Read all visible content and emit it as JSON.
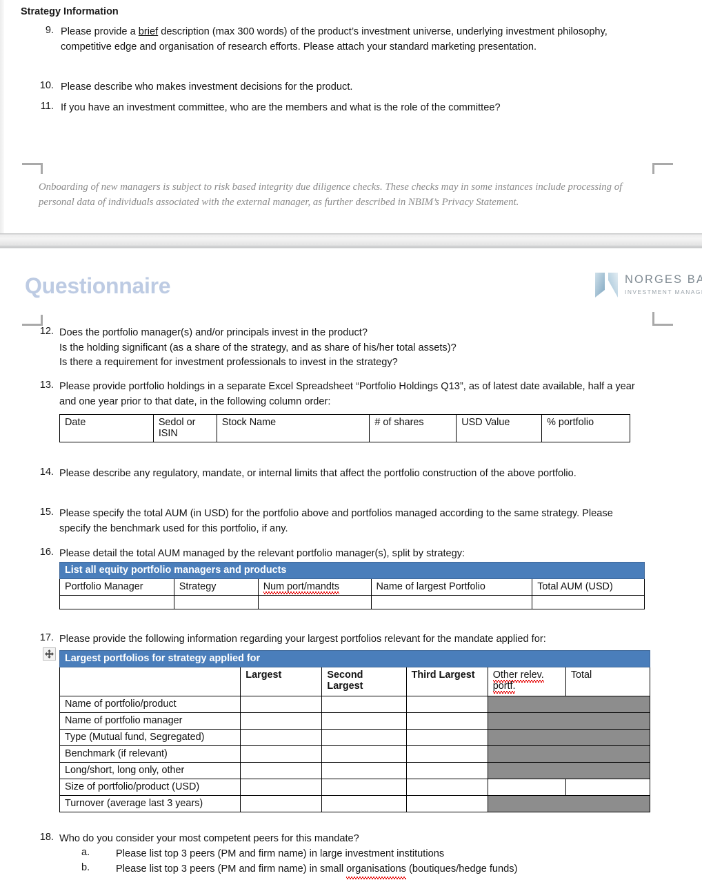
{
  "page1": {
    "section_heading": "Strategy Information",
    "questions": [
      {
        "num": "9.",
        "text": "Please provide a brief description (max 300 words) of the product’s investment universe, underlying investment philosophy, competitive edge and organisation of research efforts. Please attach your standard marketing presentation.",
        "underline_word": "brief"
      },
      {
        "num": "10.",
        "text": "Please describe who makes investment decisions for the product."
      },
      {
        "num": "11.",
        "text": "If you have an investment committee, who are the members and what is the role of the committee?"
      }
    ],
    "privacy_note": "Onboarding of new managers is subject to risk based integrity due diligence checks. These checks may in some instances include processing of personal data of individuals associated with the external manager, as further described in NBIM’s Privacy Statement."
  },
  "page2": {
    "title": "Questionnaire",
    "logo": {
      "line1": "NORGES BANK",
      "line2": "INVESTMENT MANAGEMENT",
      "mark": "nbim-n-mark"
    },
    "q12": {
      "num": "12.",
      "lines": [
        "Does the portfolio manager(s) and/or principals invest in the product?",
        "Is the holding significant (as a share of the strategy, and as share of his/her total assets)?",
        "Is there a requirement for investment professionals to invest in the strategy?"
      ]
    },
    "q13": {
      "num": "13.",
      "text": "Please provide portfolio holdings in a separate Excel Spreadsheet “Portfolio Holdings Q13”, as of latest date available, half a year and one year prior to that date, in the following column order:",
      "table": {
        "headers": [
          "Date",
          "Sedol or ISIN",
          "Stock Name",
          "# of shares",
          "USD Value",
          "% portfolio"
        ]
      }
    },
    "q14": {
      "num": "14.",
      "text": "Please describe any regulatory, mandate, or internal limits that affect the portfolio construction of the above portfolio."
    },
    "q15": {
      "num": "15.",
      "text": "Please specify the total AUM (in USD) for the portfolio above and portfolios managed according to the same strategy. Please specify the benchmark used for this portfolio, if any."
    },
    "q16": {
      "num": "16.",
      "text": "Please detail the total AUM managed by the relevant portfolio manager(s), split by strategy:",
      "table": {
        "banner": "List all equity portfolio managers and products",
        "headers": [
          "Portfolio Manager",
          "Strategy",
          "Num port/mandts",
          "Name of largest Portfolio",
          "Total AUM (USD)"
        ],
        "misspelled_header": "Num port/mandts",
        "empty_rows": 1
      }
    },
    "q17": {
      "num": "17.",
      "text": "Please provide the following information regarding your largest portfolios relevant for the mandate applied for:",
      "table": {
        "banner": "Largest portfolios for strategy applied for",
        "col_headers": [
          "",
          "Largest",
          "Second Largest",
          "Third Largest",
          "Other relev. portf.",
          "Total"
        ],
        "row_labels": [
          "Name of portfolio/product",
          "Name of portfolio manager",
          "Type (Mutual fund, Segregated)",
          "Benchmark (if relevant)",
          "Long/short, long only, other",
          "Size of portfolio/product (USD)",
          "Turnover (average last 3 years)"
        ],
        "gray_merged_rows": [
          0,
          1,
          2,
          3,
          4,
          6
        ],
        "white_split_rows": [
          5
        ]
      }
    },
    "q18": {
      "num": "18.",
      "text": "Who do you consider your most competent peers for this mandate?",
      "subitems": [
        {
          "label": "a.",
          "text": "Please list top 3 peers (PM and firm name) in large investment institutions"
        },
        {
          "label": "b.",
          "text": "Please list top 3 peers (PM and firm name) in small organisations (boutiques/hedge funds)",
          "misspelled": "organisations"
        }
      ]
    }
  },
  "colors": {
    "table_banner_blue": "#4a7ebb",
    "title_blue": "#bdcbe3",
    "gray_cell": "#8d8d8d",
    "crop_mark_gray": "#a9a9a9",
    "note_gray": "#8a8a8a",
    "spellcheck_red": "#e81313"
  }
}
